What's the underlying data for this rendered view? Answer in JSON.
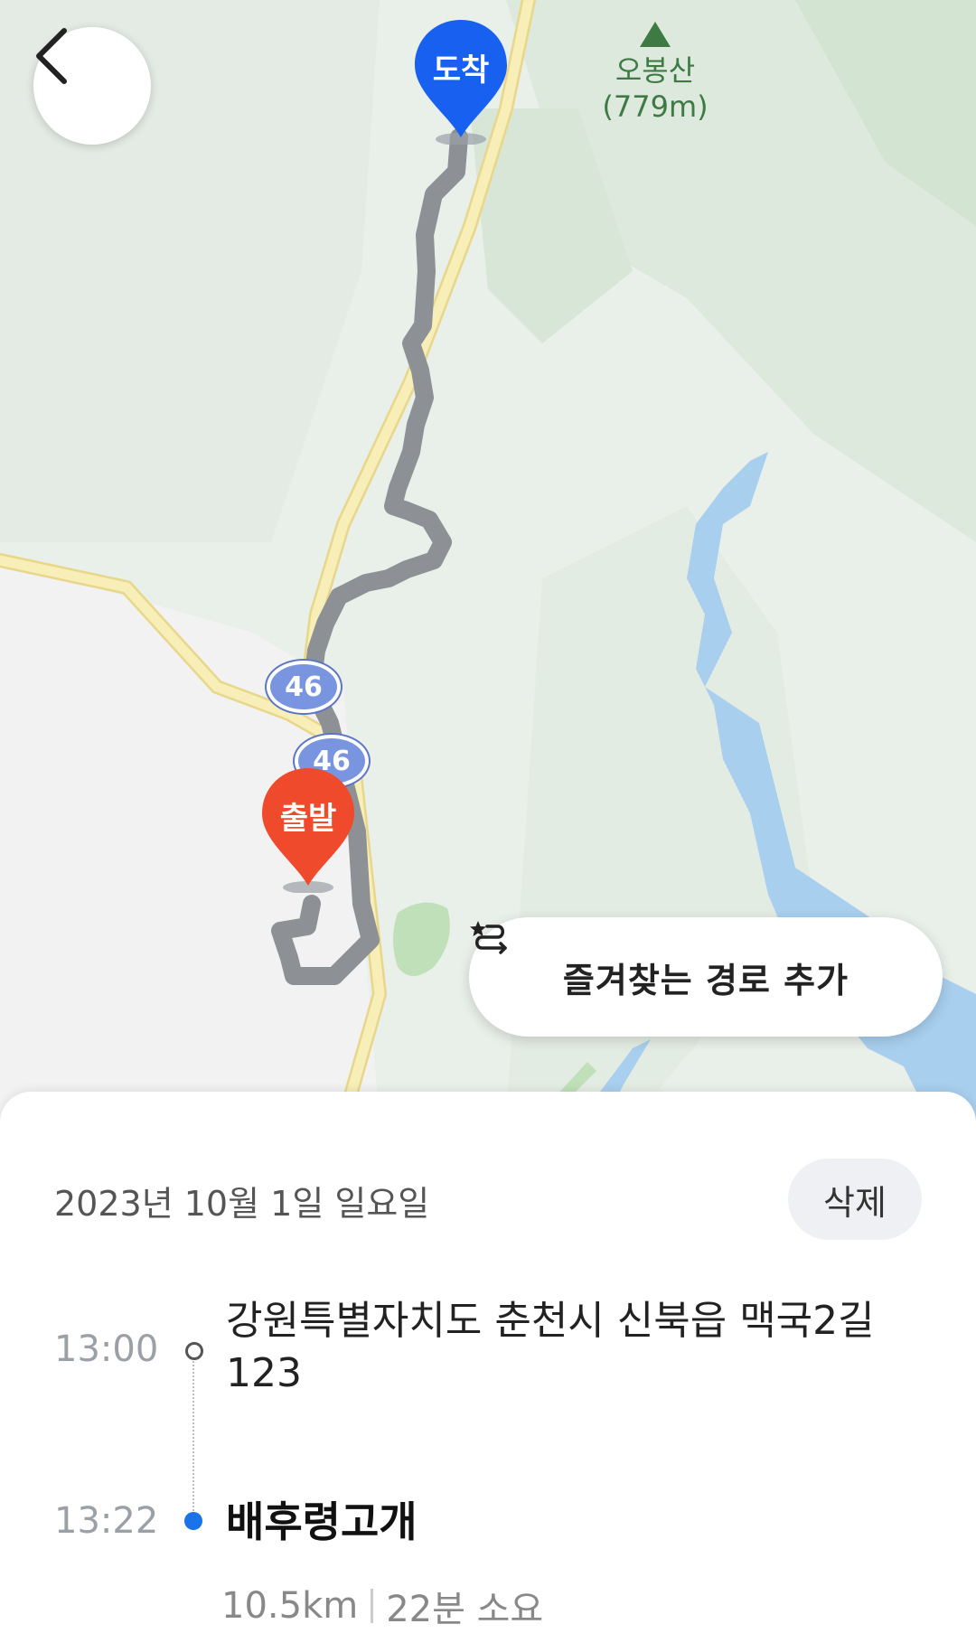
{
  "map": {
    "peak": {
      "name": "오봉산",
      "elevation": "(779m)"
    },
    "route_shields": [
      "46",
      "46"
    ],
    "start_pin": "출발",
    "end_pin": "도착",
    "favorite_button": "즐겨찾는 경로 추가",
    "colors": {
      "route": "#8d9196",
      "start": "#ef4a2b",
      "end": "#1760f0",
      "water": "#a8cfee",
      "road": "#f5eab0"
    }
  },
  "trip": {
    "date": "2023년 10월 1일 일요일",
    "delete_label": "삭제",
    "start_time": "13:00",
    "start_address": "강원특별자치도 춘천시 신북읍 맥국2길 123",
    "end_time": "13:22",
    "end_name": "배후령고개",
    "distance": "10.5km",
    "duration": "22분 소요"
  }
}
